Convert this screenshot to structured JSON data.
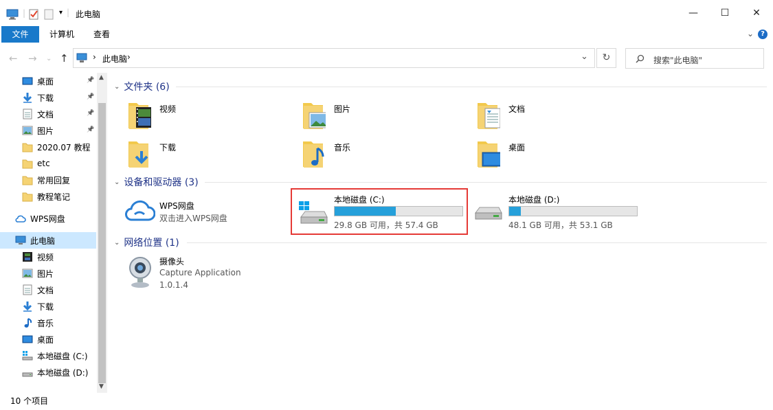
{
  "window": {
    "title": "此电脑",
    "minimize_label": "—",
    "maximize_label": "☐",
    "close_label": "✕"
  },
  "ribbon": {
    "tabs": [
      "文件",
      "计算机",
      "查看"
    ],
    "chevron": "⌄",
    "help": "?"
  },
  "address": {
    "path": "此电脑",
    "separator": "›",
    "dropdown": "⌄",
    "refresh": "↻"
  },
  "search": {
    "placeholder": "搜索\"此电脑\""
  },
  "sidebar": {
    "items": [
      {
        "label": "桌面",
        "icon": "desktop-icon",
        "pinned": true
      },
      {
        "label": "下载",
        "icon": "download-icon",
        "pinned": true
      },
      {
        "label": "文档",
        "icon": "document-icon",
        "pinned": true
      },
      {
        "label": "图片",
        "icon": "picture-icon",
        "pinned": true
      },
      {
        "label": "2020.07 教程",
        "icon": "folder-icon",
        "pinned": false
      },
      {
        "label": "etc",
        "icon": "folder-icon",
        "pinned": false
      },
      {
        "label": "常用回复",
        "icon": "folder-icon",
        "pinned": false
      },
      {
        "label": "教程笔记",
        "icon": "folder-icon",
        "pinned": false
      },
      {
        "label": "WPS网盘",
        "icon": "cloud-icon",
        "pinned": false
      },
      {
        "label": "此电脑",
        "icon": "computer-icon",
        "pinned": false
      },
      {
        "label": "视频",
        "icon": "video-icon",
        "pinned": false
      },
      {
        "label": "图片",
        "icon": "picture-icon",
        "pinned": false
      },
      {
        "label": "文档",
        "icon": "document-icon",
        "pinned": false
      },
      {
        "label": "下载",
        "icon": "download-icon",
        "pinned": false
      },
      {
        "label": "音乐",
        "icon": "music-icon",
        "pinned": false
      },
      {
        "label": "桌面",
        "icon": "desktop-icon",
        "pinned": false
      },
      {
        "label": "本地磁盘 (C:)",
        "icon": "system-drive-icon",
        "pinned": false
      },
      {
        "label": "本地磁盘 (D:)",
        "icon": "drive-icon",
        "pinned": false
      }
    ]
  },
  "groups": {
    "folders": {
      "header": "文件夹 (6)",
      "items": [
        {
          "label": "视频",
          "icon": "video-folder-icon"
        },
        {
          "label": "图片",
          "icon": "picture-folder-icon"
        },
        {
          "label": "文档",
          "icon": "document-folder-icon"
        },
        {
          "label": "下载",
          "icon": "download-folder-icon"
        },
        {
          "label": "音乐",
          "icon": "music-folder-icon"
        },
        {
          "label": "桌面",
          "icon": "desktop-folder-icon"
        }
      ]
    },
    "devices": {
      "header": "设备和驱动器 (3)",
      "wps": {
        "label": "WPS网盘",
        "sub": "双击进入WPS网盘"
      },
      "drives": [
        {
          "label": "本地磁盘 (C:)",
          "sub": "29.8 GB 可用，共 57.4 GB",
          "used_fraction": 0.48
        },
        {
          "label": "本地磁盘 (D:)",
          "sub": "48.1 GB 可用，共 53.1 GB",
          "used_fraction": 0.094
        }
      ]
    },
    "network": {
      "header": "网络位置 (1)",
      "items": [
        {
          "label": "摄像头",
          "line2": "Capture Application",
          "line3": "1.0.1.4"
        }
      ]
    }
  },
  "status": {
    "text": "10 个项目"
  },
  "colors": {
    "accent": "#1979ca",
    "drive_fill": "#26a0da",
    "group_header": "#1e3287",
    "highlight": "#e53935",
    "folder": "#f5d374"
  }
}
